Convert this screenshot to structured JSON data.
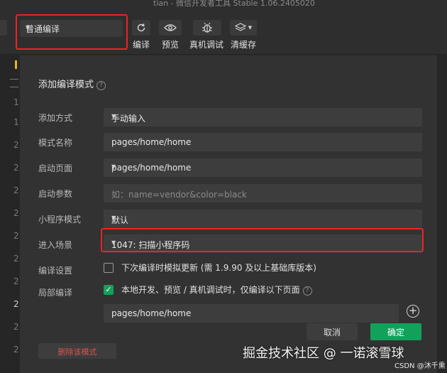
{
  "title": "tian - 微信开发者工具 Stable 1.06.2405020",
  "toolbar": {
    "mode_value": "普通编译",
    "compile_label": "编译",
    "preview_label": "预览",
    "debug_label": "真机调试",
    "cache_label": "清缓存"
  },
  "editor": {
    "line_numbers": [
      "1",
      "1",
      "2",
      "2",
      "2",
      "2",
      "2",
      "2",
      "2",
      "2",
      "2",
      "2",
      "2",
      "2"
    ]
  },
  "dialog": {
    "title": "添加编译模式",
    "fields": {
      "add_method": {
        "label": "添加方式",
        "value": "手动输入"
      },
      "mode_name": {
        "label": "模式名称",
        "value": "pages/home/home"
      },
      "start_page": {
        "label": "启动页面",
        "value": "pages/home/home"
      },
      "start_params": {
        "label": "启动参数",
        "value": "",
        "placeholder": "如：name=vendor&color=black"
      },
      "mini_mode": {
        "label": "小程序模式",
        "value": "默认"
      },
      "scene": {
        "label": "进入场景",
        "value": "1047: 扫描小程序码"
      },
      "compile_settings": {
        "label": "编译设置",
        "checkbox_text": "下次编译时模拟更新 (需 1.9.90 及以上基础库版本)",
        "checked": false
      },
      "partial_compile": {
        "label": "局部编译",
        "checkbox_text": "本地开发、预览 / 真机调试时，仅编译以下页面",
        "checked": true,
        "page_value": "pages/home/home"
      }
    },
    "delete_label": "删除该模式",
    "cancel_label": "取消",
    "ok_label": "确定"
  },
  "watermark": {
    "main": "掘金技术社区 @ 一诺滚雪球",
    "csdn": "CSDN @沐千熏"
  },
  "colors": {
    "accent": "#13a15a",
    "highlight": "#e22222",
    "danger": "#d9534f"
  }
}
